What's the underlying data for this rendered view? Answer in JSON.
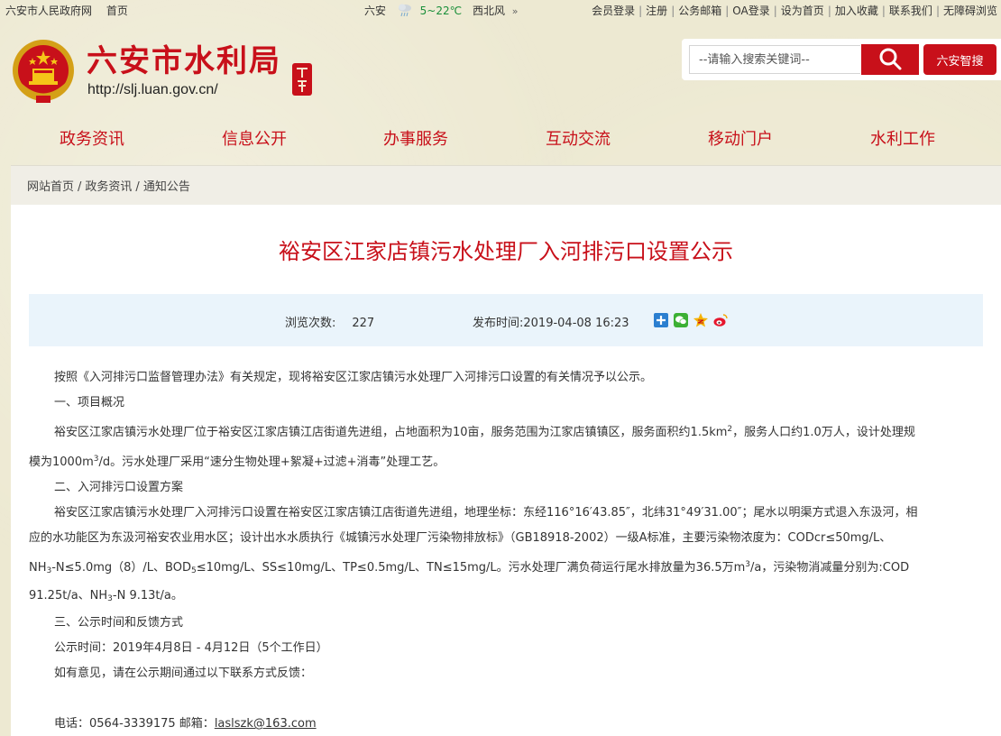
{
  "topbar": {
    "gov_site": "六安市人民政府网",
    "home": "首页",
    "weather_city": "六安",
    "weather_temp": "5~22℃",
    "weather_wind": "西北风",
    "links": [
      "会员登录",
      "注册",
      "公务邮箱",
      "OA登录",
      "设为首页",
      "加入收藏",
      "联系我们",
      "无障碍浏览"
    ]
  },
  "header": {
    "title": "六安市水利局",
    "url": "http://slj.luan.gov.cn/",
    "search_placeholder": "--请输入搜索关键词--",
    "smart_search": "六安智搜"
  },
  "nav": [
    "政务资讯",
    "信息公开",
    "办事服务",
    "互动交流",
    "移动门户",
    "水利工作"
  ],
  "breadcrumb": [
    "网站首页",
    "政务资讯",
    "通知公告"
  ],
  "article": {
    "title": "裕安区江家店镇污水处理厂入河排污口设置公示",
    "views_label": "浏览次数:",
    "views": "227",
    "date_label": "发布时间:",
    "date": "2019-04-08 16:23",
    "p1": "按照《入河排污口监督管理办法》有关规定，现将裕安区江家店镇污水处理厂入河排污口设置的有关情况予以公示。",
    "h1": "一、项目概况",
    "p2a": "裕安区江家店镇污水处理厂位于裕安区江家店镇江店街道先进组，占地面积为10亩，服务范围为江家店镇镇区，服务面积约1.5km",
    "p2b": "，服务人口约1.0万人，设计处理规",
    "p2c": "模为1000m",
    "p2d": "/d。污水处理厂采用“速分生物处理+絮凝+过滤+消毒”处理工艺。",
    "h2": "二、入河排污口设置方案",
    "p3a": "裕安区江家店镇污水处理厂入河排污口设置在裕安区江家店镇江店街道先进组，地理坐标：东经116°16′43.85″，北纬31°49′31.00″；尾水以明渠方式退入东汲河，相",
    "p3b": "应的水功能区为东汲河裕安农业用水区；设计出水水质执行《城镇污水处理厂污染物排放标》（GB18918-2002）一级A标准，主要污染物浓度为：CODcr≤50mg/L、",
    "p3c1": "NH",
    "p3c2": "-N≤5.0mg（8）/L、BOD",
    "p3c3": "≤10mg/L、SS≤10mg/L、TP≤0.5mg/L、TN≤15mg/L。污水处理厂满负荷运行尾水排放量为36.5万m",
    "p3c4": "/a，污染物消减量分别为:COD",
    "p3d1": "91.25t/a、NH",
    "p3d2": "-N 9.13t/a。",
    "h3": "三、公示时间和反馈方式",
    "p4": "公示时间：2019年4月8日 - 4月12日（5个工作日）",
    "p5": "如有意见，请在公示期间通过以下联系方式反馈：",
    "contact_phone": "电话：0564-3339175  邮箱：",
    "contact_email": "laslszk@163.com",
    "sup2": "2",
    "sup3": "3",
    "sub3": "3",
    "sub5": "5"
  },
  "colors": {
    "brand_red": "#c8101a",
    "page_bg": "#ede9d2",
    "info_bar": "#eaf4fb"
  }
}
